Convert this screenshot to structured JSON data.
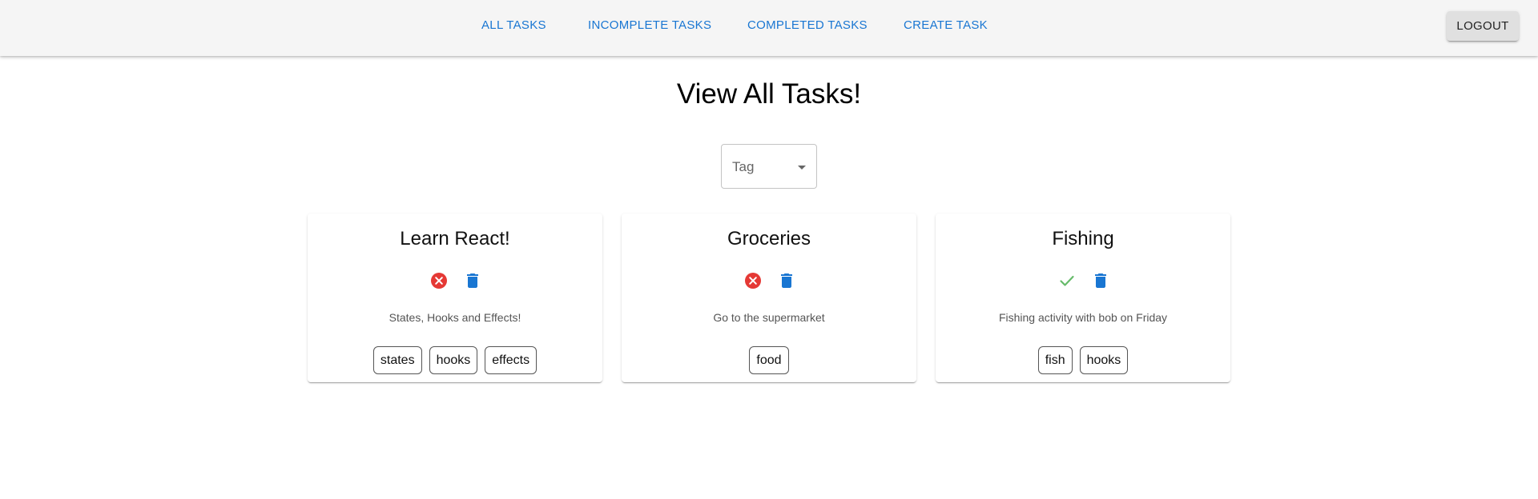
{
  "nav": {
    "links": [
      "ALL TASKS",
      "INCOMPLETE TASKS",
      "COMPLETED TASKS",
      "CREATE TASK"
    ],
    "logout_label": "LOGOUT"
  },
  "page": {
    "title": "View All Tasks!"
  },
  "filter": {
    "label": "Tag"
  },
  "colors": {
    "link": "#1976d2",
    "incomplete": "#e53935",
    "complete": "#66bb6a",
    "delete": "#1976d2"
  },
  "tasks": [
    {
      "title": "Learn React!",
      "status_icon": "cancel-icon",
      "description": "States, Hooks and Effects!",
      "tags": [
        "states",
        "hooks",
        "effects"
      ]
    },
    {
      "title": "Groceries",
      "status_icon": "cancel-icon",
      "description": "Go to the supermarket",
      "tags": [
        "food"
      ]
    },
    {
      "title": "Fishing",
      "status_icon": "check-icon",
      "description": "Fishing activity with bob on Friday",
      "tags": [
        "fish",
        "hooks"
      ]
    }
  ]
}
